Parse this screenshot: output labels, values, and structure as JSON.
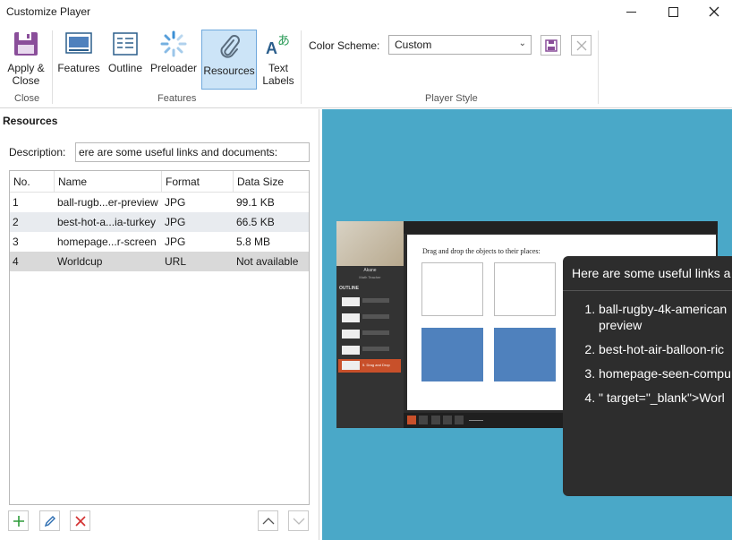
{
  "window": {
    "title": "Customize Player"
  },
  "ribbon": {
    "apply_close": {
      "label_line1": "Apply &",
      "label_line2": "Close"
    },
    "close_group_label": "Close",
    "features_group_label": "Features",
    "player_style_group_label": "Player Style",
    "buttons": [
      {
        "label": "Features"
      },
      {
        "label": "Outline"
      },
      {
        "label": "Preloader"
      },
      {
        "label": "Resources"
      },
      {
        "label_line1": "Text",
        "label_line2": "Labels"
      }
    ],
    "color_scheme": {
      "label": "Color Scheme:",
      "value": "Custom"
    }
  },
  "resources": {
    "title": "Resources",
    "description_label": "Description:",
    "description_value": "ere are some useful links and documents:",
    "columns": [
      "No.",
      "Name",
      "Format",
      "Data Size"
    ],
    "rows": [
      {
        "no": "1",
        "name": "ball-rugb...er-preview",
        "format": "JPG",
        "size": "99.1 KB"
      },
      {
        "no": "2",
        "name": "best-hot-a...ia-turkey",
        "format": "JPG",
        "size": "66.5 KB"
      },
      {
        "no": "3",
        "name": "homepage...r-screen",
        "format": "JPG",
        "size": "5.8 MB"
      },
      {
        "no": "4",
        "name": "Worldcup",
        "format": "URL",
        "size": "Not available"
      }
    ]
  },
  "preview": {
    "player": {
      "slide_title": "Drag and drop the objects to their places:",
      "presenter_name": "Akane",
      "presenter_role": "Math Teacher",
      "outline_label": "OUTLINE",
      "active_item": "5. Drag and Drop"
    },
    "popup": {
      "title": "Here are some useful links a",
      "items": [
        {
          "line1": "ball-rugby-4k-american",
          "line2": "preview"
        },
        {
          "line1": "best-hot-air-balloon-ric"
        },
        {
          "line1": "homepage-seen-compu"
        },
        {
          "line1": "\" target=\"_blank\">Worl"
        }
      ]
    }
  },
  "colors": {
    "accent": "#cce4f7",
    "preview_bg": "#4aa8c8",
    "selected_row": "#d9d9d9"
  }
}
